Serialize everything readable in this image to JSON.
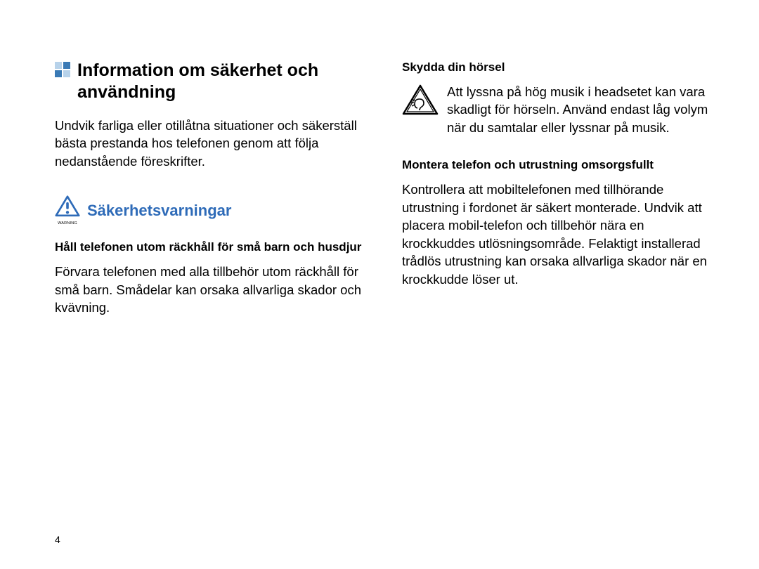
{
  "title": "Information om säkerhet och användning",
  "intro": "Undvik farliga eller otillåtna situationer och säkerställ bästa prestanda hos telefonen genom att följa nedanstående föreskrifter.",
  "warnings_heading": "Säkerhetsvarningar",
  "warning_label": "WARNING",
  "section1_heading": "Håll telefonen utom räckhåll för små barn och husdjur",
  "section1_body": "Förvara telefonen med alla tillbehör utom räckhåll för små barn. Smådelar kan orsaka allvarliga skador och kvävning.",
  "section2_heading": "Skydda din hörsel",
  "section2_body": "Att lyssna på hög musik i headsetet kan vara skadligt för hörseln. Använd endast låg volym när du samtalar eller lyssnar på musik.",
  "section3_heading": "Montera telefon och utrustning omsorgsfullt",
  "section3_body": "Kontrollera att mobiltelefonen med tillhörande utrustning i fordonet är säkert monterade. Undvik att placera mobil-telefon och tillbehör nära en krockkuddes utlösningsområde. Felaktigt installerad trådlös utrustning kan orsaka allvarliga skador när en krockkudde löser ut.",
  "page_number": "4"
}
